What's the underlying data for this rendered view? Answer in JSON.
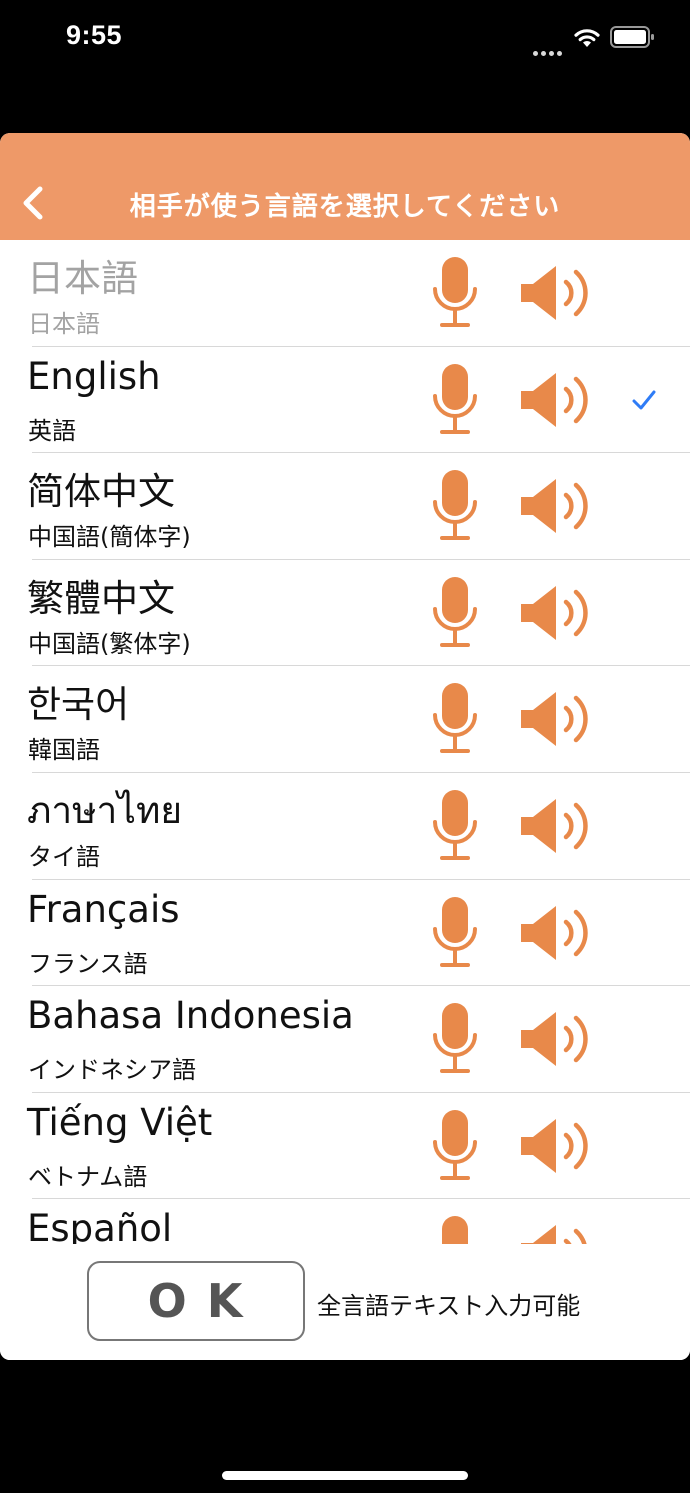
{
  "status_bar": {
    "time": "9:55"
  },
  "header": {
    "title": "相手が使う言語を選択してください"
  },
  "languages": [
    {
      "name": "日本語",
      "sub": "日本語",
      "disabled": true,
      "selected": false
    },
    {
      "name": "English",
      "sub": "英語",
      "disabled": false,
      "selected": true
    },
    {
      "name": "简体中文",
      "sub": "中国語(簡体字)",
      "disabled": false,
      "selected": false
    },
    {
      "name": "繁體中文",
      "sub": "中国語(繁体字)",
      "disabled": false,
      "selected": false
    },
    {
      "name": "한국어",
      "sub": "韓国語",
      "disabled": false,
      "selected": false
    },
    {
      "name": "ภาษาไทย",
      "sub": "タイ語",
      "disabled": false,
      "selected": false
    },
    {
      "name": "Français",
      "sub": "フランス語",
      "disabled": false,
      "selected": false
    },
    {
      "name": "Bahasa Indonesia",
      "sub": "インドネシア語",
      "disabled": false,
      "selected": false
    },
    {
      "name": "Tiếng Việt",
      "sub": "ベトナム語",
      "disabled": false,
      "selected": false
    },
    {
      "name": "Español",
      "sub": "",
      "disabled": false,
      "selected": false
    }
  ],
  "footer": {
    "ok_label": "OK",
    "note": "全言語テキスト入力可能"
  },
  "colors": {
    "accent": "#ee9968",
    "icon": "#e8894a",
    "check": "#2f7cf6"
  }
}
